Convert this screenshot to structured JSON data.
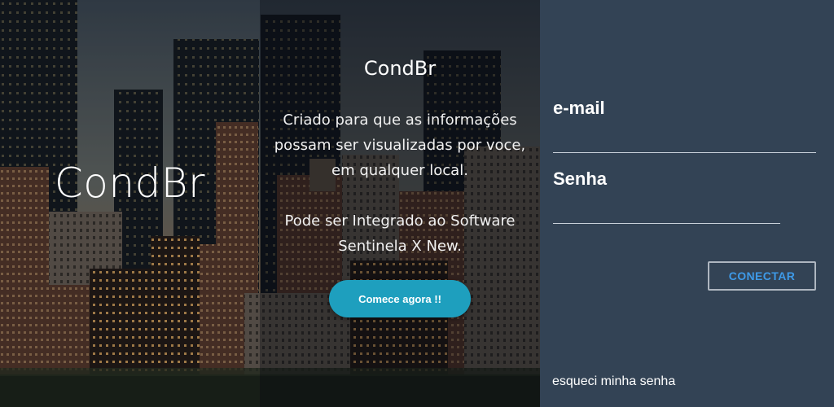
{
  "left_panel": {
    "brand": "CondBr"
  },
  "middle_panel": {
    "title": "CondBr",
    "description": "Criado para que as informações possam ser visualizadas por voce, em qualquer local.",
    "integration": "Pode ser Integrado ao Software Sentinela X New.",
    "start_button_label": "Comece agora !!"
  },
  "login": {
    "email_label": "e-mail",
    "email_value": "",
    "password_label": "Senha",
    "password_value": "",
    "connect_button_label": "CONECTAR",
    "forgot_password_link": "esqueci minha senha"
  },
  "colors": {
    "login_panel_bg": "#334355",
    "start_button_bg": "#1e9fbe",
    "connect_text": "#3e9ae8"
  }
}
